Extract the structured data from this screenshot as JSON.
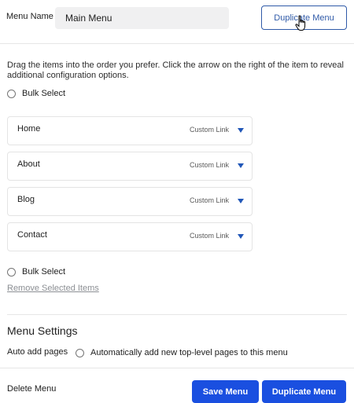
{
  "header": {
    "menu_name_label": "Menu Name",
    "menu_name_value": "Main Menu",
    "duplicate_label": "Duplicate Menu"
  },
  "instructions": "Drag the items into the order you prefer. Click the arrow on the right of the item to reveal additional configuration options.",
  "bulk_select_label": "Bulk Select",
  "menu_items": [
    {
      "title": "Home",
      "type": "Custom Link"
    },
    {
      "title": "About",
      "type": "Custom Link"
    },
    {
      "title": "Blog",
      "type": "Custom Link"
    },
    {
      "title": "Contact",
      "type": "Custom Link"
    }
  ],
  "remove_selected_label": "Remove Selected Items",
  "settings": {
    "title": "Menu Settings",
    "auto_add_label": "Auto add pages",
    "auto_add_option": "Automatically add new top-level pages to this menu"
  },
  "footer": {
    "delete_label": "Delete Menu",
    "save_label": "Save Menu",
    "duplicate_label": "Duplicate Menu"
  },
  "colors": {
    "primary": "#1a4fe0",
    "outline_accent": "#2f5aa8",
    "arrow": "#2157b8"
  }
}
